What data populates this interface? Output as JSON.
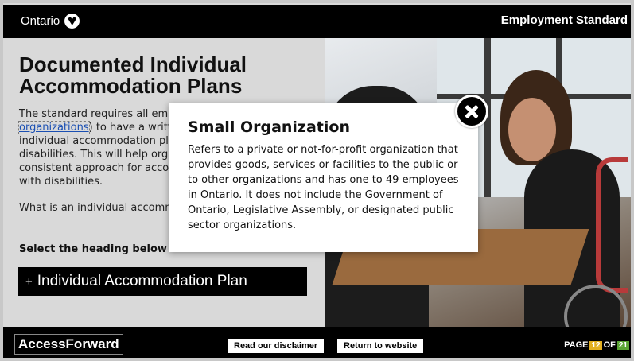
{
  "header": {
    "brand": "Ontario",
    "module_title": "Employment Standard"
  },
  "content": {
    "title": "Documented Individual Accommodation Plans",
    "paragraph1_pre": "The standard requires all em",
    "paragraph1_link": "organizations",
    "paragraph1_mid": ") to have a writt",
    "paragraph1_rest": "individual accommodation pl disabilities. This will help org consistent approach for acco with disabilities.",
    "paragraph2": "What is an individual accomm",
    "select_heading": "Select the heading below to find out.",
    "accordion_label": "Individual Accommodation Plan",
    "accordion_icon": "+"
  },
  "modal": {
    "title": "Small Organization",
    "body": "Refers to a private or not-for-profit organization that provides goods, services or facilities to the public or to other organizations and has one to 49 employees in Ontario. It does not include the Government of Ontario, Legislative Assembly, or designated public sector organizations.",
    "close_icon": "close-icon"
  },
  "footer": {
    "logo": "AccessForward",
    "disclaimer_button": "Read our disclaimer",
    "return_button": "Return to website",
    "page_label": "PAGE",
    "page_current": "12",
    "page_of": "OF",
    "page_total": "21"
  },
  "colors": {
    "accent_page": "#e3b021",
    "accent_total": "#5aa533",
    "link": "#1a4fb3"
  }
}
